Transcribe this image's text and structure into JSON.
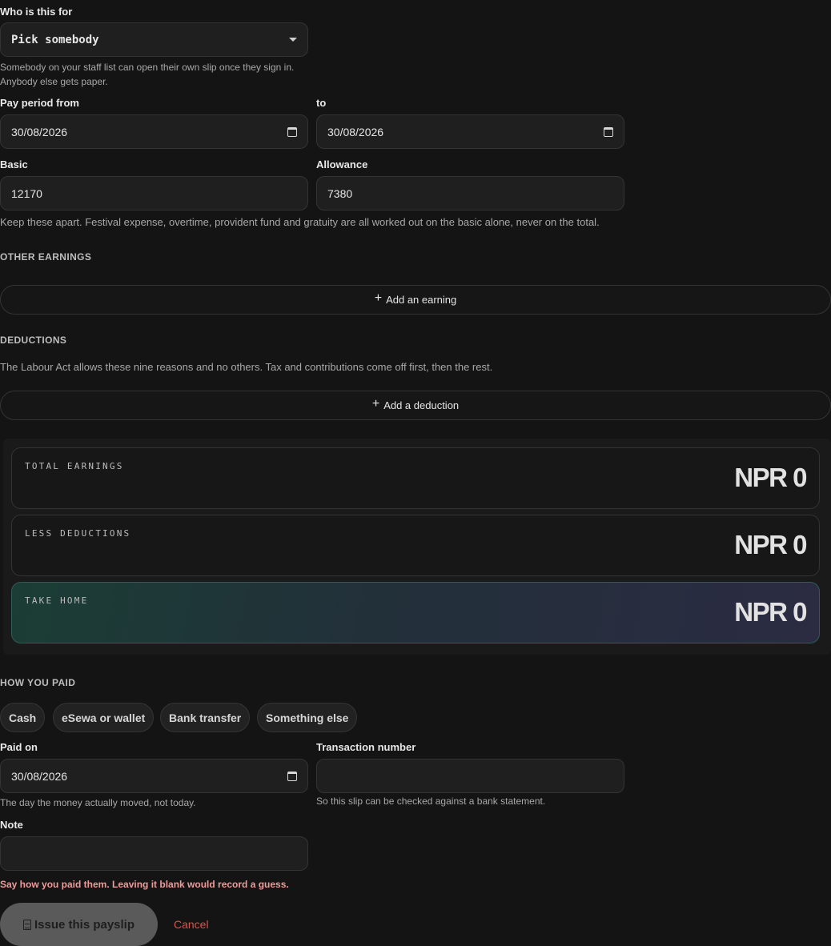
{
  "recipient": {
    "label": "Who is this for",
    "value": "Pick somebody",
    "hint_line1": "Somebody on your staff list can open their own slip once they sign in.",
    "hint_line2": "Anybody else gets paper."
  },
  "period": {
    "from_label": "Pay period from",
    "from_value": "30/08/2026",
    "to_label": "to",
    "to_value": "30/08/2026"
  },
  "pay": {
    "basic_label": "Basic",
    "basic_value": "12170",
    "allowance_label": "Allowance",
    "allowance_value": "7380",
    "hint": "Keep these apart. Festival expense, overtime, provident fund and gratuity are all worked out on the basic alone, never on the total."
  },
  "other_earnings": {
    "heading": "OTHER EARNINGS",
    "add_label": "Add an earning"
  },
  "deductions": {
    "heading": "DEDUCTIONS",
    "hint": "The Labour Act allows these nine reasons and no others. Tax and contributions come off first, then the rest.",
    "add_label": "Add a deduction"
  },
  "totals": {
    "earnings_label": "TOTAL EARNINGS",
    "earnings_value": "NPR 0",
    "deductions_label": "LESS DEDUCTIONS",
    "deductions_value": "NPR 0",
    "home_label": "TAKE HOME",
    "home_value": "NPR 0"
  },
  "payment": {
    "heading": "HOW YOU PAID",
    "methods": [
      "Cash",
      "eSewa or wallet",
      "Bank transfer",
      "Something else"
    ],
    "paid_on_label": "Paid on",
    "paid_on_value": "30/08/2026",
    "paid_on_hint": "The day the money actually moved, not today.",
    "txn_label": "Transaction number",
    "txn_value": "",
    "txn_hint": "So this slip can be checked against a bank statement.",
    "note_label": "Note",
    "note_value": ""
  },
  "error": "Say how you paid them. Leaving it blank would record a guess.",
  "actions": {
    "issue_label": "Issue this payslip",
    "cancel_label": "Cancel"
  },
  "colors": {
    "background": "#141414",
    "error": "#f29a9a",
    "cancel": "#d9534f",
    "take_home_gradient_start": "#1b3d35",
    "take_home_gradient_end": "#2b2b42"
  }
}
